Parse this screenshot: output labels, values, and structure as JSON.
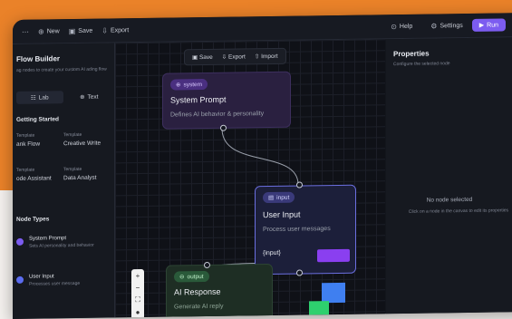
{
  "colors": {
    "accent": "#7c5cf0",
    "system_node": "#2a2040",
    "input_node": "#3a3a7a",
    "output_node": "#1e2e24",
    "orange": "#ea8229"
  },
  "topbar": {
    "items": [
      {
        "icon": "⋯",
        "label": ""
      },
      {
        "icon": "⊕",
        "label": "New"
      },
      {
        "icon": "▣",
        "label": "Save"
      },
      {
        "icon": "⇩",
        "label": "Export"
      }
    ],
    "help": "Help",
    "settings": "Settings",
    "run": "Run"
  },
  "sidebar": {
    "title": "Flow Builder",
    "subtitle": "ag nodes to create your custom AI ading flow",
    "tabs": [
      {
        "icon": "☷",
        "label": "Lab"
      },
      {
        "icon": "⊕",
        "label": "Text"
      }
    ],
    "getting_started": "Getting Started",
    "templates": [
      {
        "kind": "Template",
        "name": "ank Flow"
      },
      {
        "kind": "Template",
        "name": "Creative Write"
      },
      {
        "kind": "Template",
        "name": "ode Assistant"
      },
      {
        "kind": "Template",
        "name": "Data Analyst"
      }
    ],
    "node_types_title": "Node Types",
    "node_types": [
      {
        "name": "System Prompt",
        "desc": "Sets AI personality and behavior",
        "color": "#7c5cf0"
      },
      {
        "name": "User Input",
        "desc": "Processes user message",
        "color": "#5b6cf0"
      }
    ]
  },
  "canvas": {
    "toolbar": {
      "save": "Save",
      "export": "Export",
      "import": "Import"
    },
    "system_node": {
      "tag": "system",
      "title": "System Prompt",
      "desc": "Defines AI behavior & personality"
    },
    "input_node": {
      "tag": "input",
      "title": "User Input",
      "desc": "Process user messages",
      "value": "{input}"
    },
    "output_node": {
      "tag": "output",
      "title": "AI Response",
      "desc": "Generate AI reply"
    },
    "zoom": [
      "+",
      "−",
      "⛶",
      "●"
    ]
  },
  "properties": {
    "title": "Properties",
    "subtitle": "Configure the selected node",
    "empty": "No node selected",
    "hint": "Click on a node in the canvas to edit its properties"
  }
}
